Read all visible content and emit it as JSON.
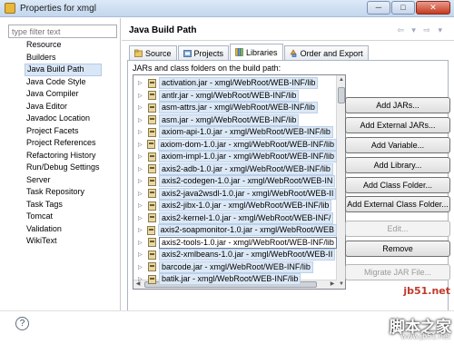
{
  "window": {
    "title": "Properties for xmgl",
    "minimize": "─",
    "maximize": "□",
    "close": "✕"
  },
  "sidebar": {
    "filter_placeholder": "type filter text",
    "items": [
      {
        "label": "Resource"
      },
      {
        "label": "Builders"
      },
      {
        "label": "Java Build Path",
        "selected": true
      },
      {
        "label": "Java Code Style"
      },
      {
        "label": "Java Compiler"
      },
      {
        "label": "Java Editor"
      },
      {
        "label": "Javadoc Location"
      },
      {
        "label": "Project Facets"
      },
      {
        "label": "Project References"
      },
      {
        "label": "Refactoring History"
      },
      {
        "label": "Run/Debug Settings"
      },
      {
        "label": "Server"
      },
      {
        "label": "Task Repository"
      },
      {
        "label": "Task Tags"
      },
      {
        "label": "Tomcat"
      },
      {
        "label": "Validation"
      },
      {
        "label": "WikiText"
      }
    ]
  },
  "main": {
    "title": "Java Build Path",
    "nav_arrows": "⇦ ▾ ⇨ ▾",
    "tabs": [
      {
        "label": "Source"
      },
      {
        "label": "Projects"
      },
      {
        "label": "Libraries",
        "active": true
      },
      {
        "label": "Order and Export"
      }
    ],
    "list_caption": "JARs and class folders on the build path:",
    "jars": [
      {
        "label": "activation.jar - xmgl/WebRoot/WEB-INF/lib",
        "highlight": true
      },
      {
        "label": "antlr.jar - xmgl/WebRoot/WEB-INF/lib",
        "highlight": true
      },
      {
        "label": "asm-attrs.jar - xmgl/WebRoot/WEB-INF/lib",
        "highlight": true
      },
      {
        "label": "asm.jar - xmgl/WebRoot/WEB-INF/lib",
        "highlight": true
      },
      {
        "label": "axiom-api-1.0.jar - xmgl/WebRoot/WEB-INF/lib",
        "highlight": true
      },
      {
        "label": "axiom-dom-1.0.jar - xmgl/WebRoot/WEB-INF/lib",
        "highlight": true
      },
      {
        "label": "axiom-impl-1.0.jar - xmgl/WebRoot/WEB-INF/lib",
        "highlight": true
      },
      {
        "label": "axis2-adb-1.0.jar - xmgl/WebRoot/WEB-INF/lib",
        "highlight": true
      },
      {
        "label": "axis2-codegen-1.0.jar - xmgl/WebRoot/WEB-IN",
        "highlight": true
      },
      {
        "label": "axis2-java2wsdl-1.0.jar - xmgl/WebRoot/WEB-II",
        "highlight": true
      },
      {
        "label": "axis2-jibx-1.0.jar - xmgl/WebRoot/WEB-INF/lib",
        "highlight": true
      },
      {
        "label": "axis2-kernel-1.0.jar - xmgl/WebRoot/WEB-INF/",
        "highlight": true
      },
      {
        "label": "axis2-soapmonitor-1.0.jar - xmgl/WebRoot/WEB",
        "highlight": true
      },
      {
        "label": "axis2-tools-1.0.jar - xmgl/WebRoot/WEB-INF/lib",
        "current": true
      },
      {
        "label": "axis2-xmlbeans-1.0.jar - xmgl/WebRoot/WEB-II",
        "highlight": true
      },
      {
        "label": "barcode.jar - xmgl/WebRoot/WEB-INF/lib",
        "highlight": true
      },
      {
        "label": "batik.jar - xmgl/WebRoot/WEB-INF/lib",
        "highlight": true
      }
    ],
    "buttons": [
      {
        "label": "Add JARs...",
        "enabled": true
      },
      {
        "label": "Add External JARs...",
        "enabled": true
      },
      {
        "label": "Add Variable...",
        "enabled": true
      },
      {
        "label": "Add Library...",
        "enabled": true
      },
      {
        "label": "Add Class Folder...",
        "enabled": true
      },
      {
        "label": "Add External Class Folder...",
        "enabled": true
      },
      {
        "label": "Edit...",
        "enabled": false
      },
      {
        "label": "Remove",
        "enabled": true
      },
      {
        "label": "Migrate JAR File...",
        "enabled": false
      }
    ]
  },
  "footer": {
    "help": "?"
  },
  "watermark": {
    "site": "jb51.net",
    "name": "脚本之家",
    "url": "www.jb51.net"
  }
}
